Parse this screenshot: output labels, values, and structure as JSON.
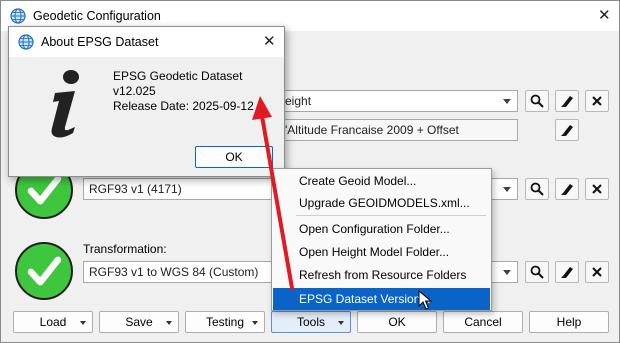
{
  "main": {
    "title": "Geodetic Configuration",
    "height_combo": "eight",
    "height_field": "'Altitude Francaise 2009 + Offset",
    "crs_combo": "RGF93 v1 (4171)",
    "transformation_label": "Transformation:",
    "transformation_field": "RGF93 v1 to WGS 84 (Custom)"
  },
  "about": {
    "title": "About EPSG Dataset",
    "line1": "EPSG Geodetic Dataset v12.025",
    "line2": "Release Date: 2025-09-12",
    "ok": "OK"
  },
  "menu": {
    "items": [
      "Create Geoid Model...",
      "Upgrade GEOIDMODELS.xml...",
      "Open Configuration Folder...",
      "Open Height Model Folder...",
      "Refresh from Resource Folders",
      "EPSG Dataset Version..."
    ]
  },
  "buttons": {
    "load": "Load",
    "save": "Save",
    "testing": "Testing",
    "tools": "Tools",
    "ok": "OK",
    "cancel": "Cancel",
    "help": "Help"
  },
  "colors": {
    "accent": "#0a64c8",
    "check_green": "#3ec63e",
    "arrow_red": "#e01b24"
  }
}
